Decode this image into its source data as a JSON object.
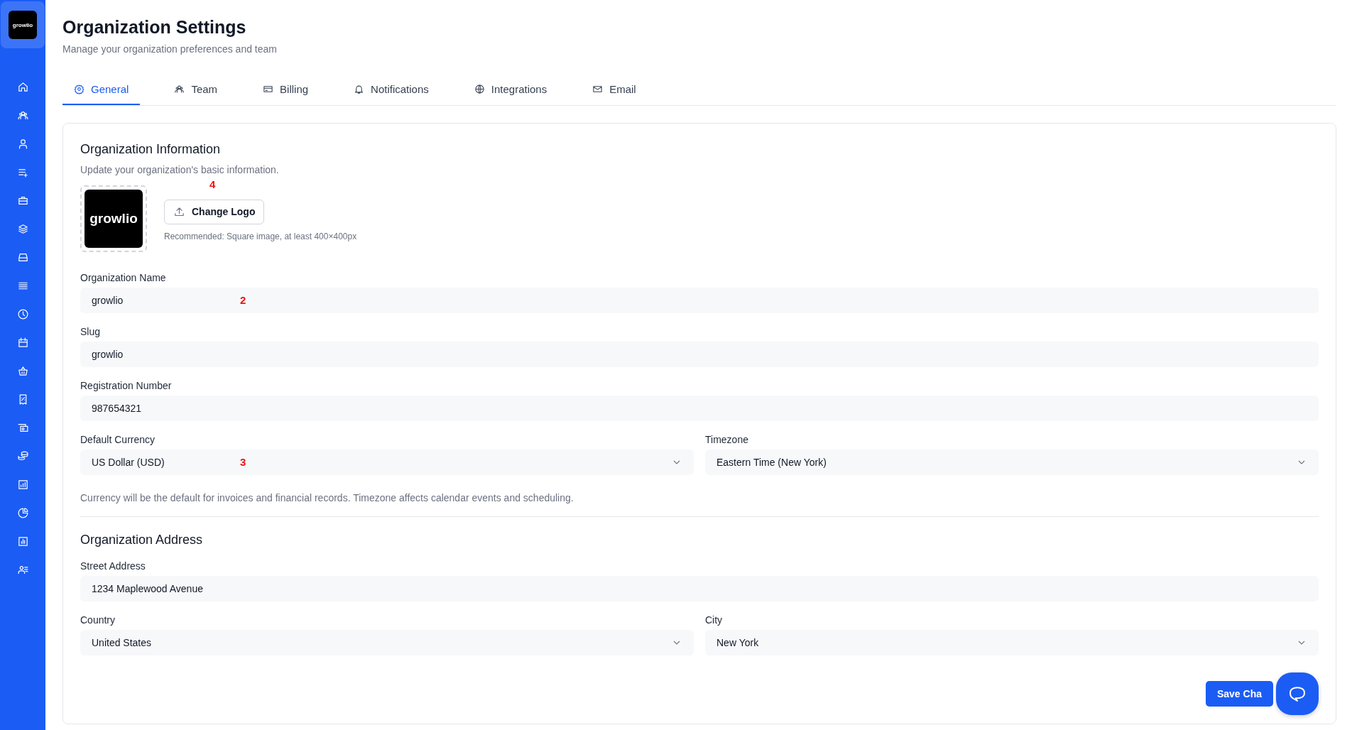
{
  "sidebar": {
    "logo": "growlio"
  },
  "header": {
    "title": "Organization Settings",
    "subtitle": "Manage your organization preferences and team"
  },
  "tabs": [
    {
      "label": "General",
      "selected": true
    },
    {
      "label": "Team",
      "selected": false
    },
    {
      "label": "Billing",
      "selected": false
    },
    {
      "label": "Notifications",
      "selected": false
    },
    {
      "label": "Integrations",
      "selected": false
    },
    {
      "label": "Email",
      "selected": false
    }
  ],
  "organization_information": {
    "title": "Organization Information",
    "subtitle": "Update your organization's basic information.",
    "logo": "growlio",
    "change_logo_button": "Change Logo",
    "marker": "4",
    "logo_hint": "Recommended: Square image, at least 400×400px",
    "rows": [
      [
        {
          "label": "Organization Name",
          "kind": "text",
          "value": "growlio",
          "marker": "2"
        }
      ],
      [
        {
          "label": "Slug",
          "kind": "text",
          "value": "growlio"
        }
      ],
      [
        {
          "label": "Registration Number",
          "kind": "text",
          "value": "987654321"
        }
      ],
      [
        {
          "label": "Default Currency",
          "kind": "select",
          "value": "US Dollar (USD)",
          "marker": "3"
        },
        {
          "label": "Timezone",
          "kind": "select",
          "value": "Eastern Time (New York)"
        }
      ]
    ],
    "help": "Currency will be the default for invoices and financial records. Timezone affects calendar events and scheduling."
  },
  "organization_address": {
    "title": "Organization Address",
    "rows": [
      [
        {
          "label": "Street Address",
          "kind": "text",
          "value": "1234 Maplewood Avenue"
        }
      ],
      [
        {
          "label": "Country",
          "kind": "select",
          "value": "United States"
        },
        {
          "label": "City",
          "kind": "select",
          "value": "New York"
        }
      ]
    ]
  },
  "save_button": "Save Cha"
}
